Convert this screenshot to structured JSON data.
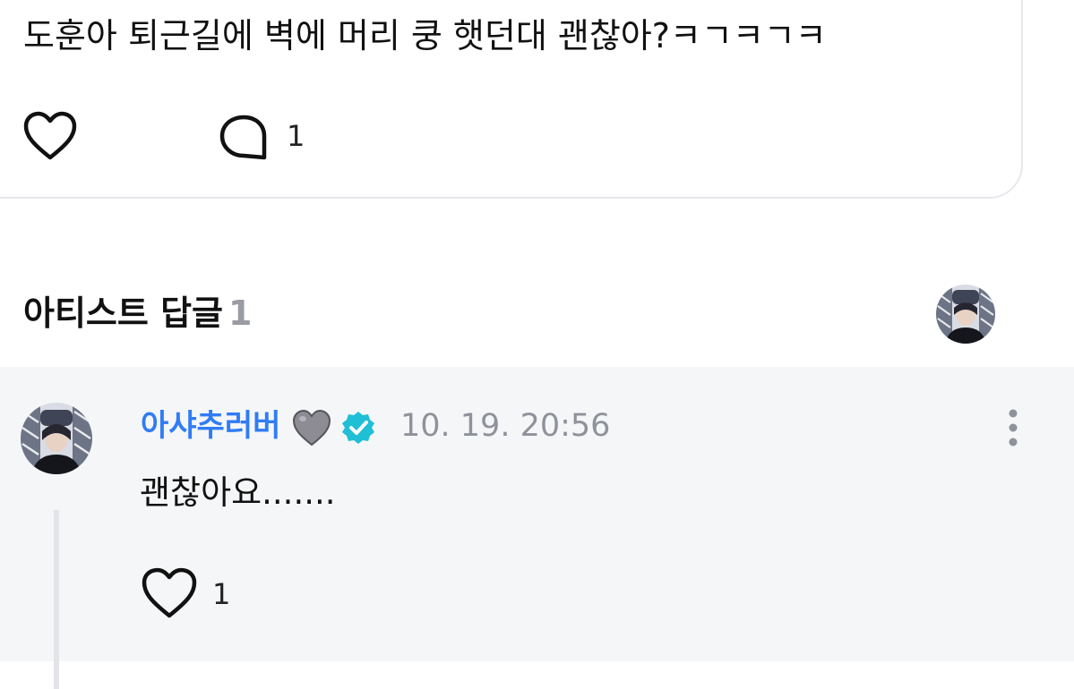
{
  "post": {
    "text": "도훈아 퇴근길에 벽에 머리 쿵 햇던대 괜찮아?ㅋㄱㅋㄱㅋ",
    "comment_count": "1",
    "icons": {
      "like": "heart-outline-icon",
      "comment": "speech-bubble-icon"
    }
  },
  "artist_replies": {
    "title": "아티스트 답글",
    "count": "1"
  },
  "reply": {
    "author": "아샤추러버",
    "author_emoji": "grey-heart-emoji",
    "verified": true,
    "date": "10. 19. 20:56",
    "text": "괜찮아요.......",
    "like_count": "1",
    "icons": {
      "like": "heart-outline-icon",
      "more": "more-vertical-icon",
      "verified": "verified-badge-icon"
    }
  },
  "colors": {
    "author_name": "#2f7cf6",
    "verified_badge": "#1fbfd6",
    "muted_text": "#8f929a",
    "reply_background": "#f5f6f8"
  }
}
